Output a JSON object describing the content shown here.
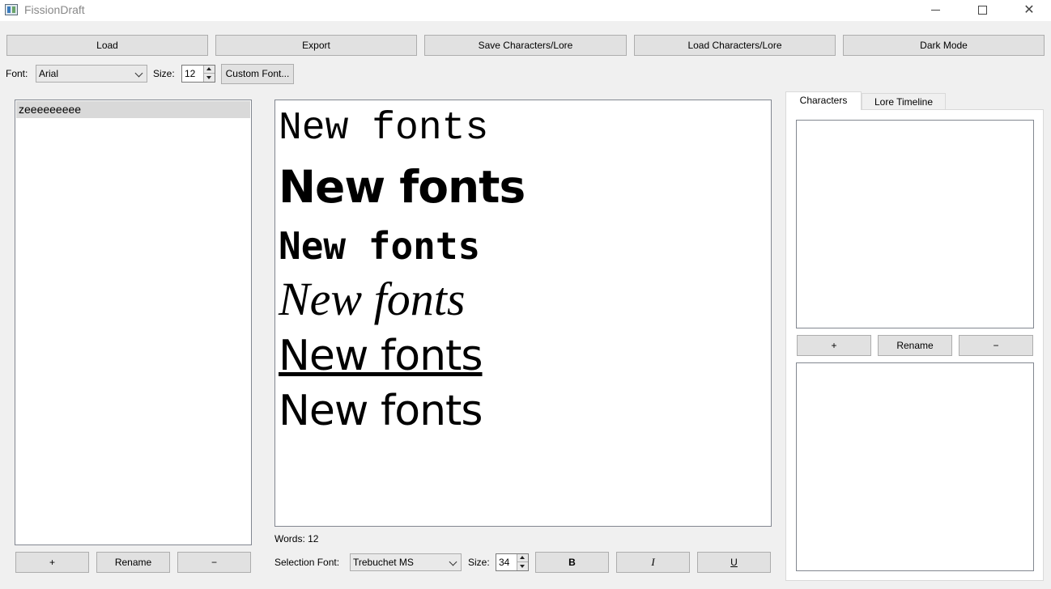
{
  "window": {
    "title": "FissionDraft",
    "app_icon": "app-icon",
    "controls": {
      "minimize": "minimize-icon",
      "maximize": "maximize-icon",
      "close": "✕"
    }
  },
  "toolbar": {
    "load": "Load",
    "export": "Export",
    "save_characters_lore": "Save Characters/Lore",
    "load_characters_lore": "Load Characters/Lore",
    "dark_mode": "Dark Mode"
  },
  "font_row": {
    "font_label": "Font:",
    "font_value": "Arial",
    "size_label": "Size:",
    "size_value": "12",
    "custom_font": "Custom Font..."
  },
  "chapters": {
    "items": [
      "zeeeeeeeee"
    ],
    "add": "+",
    "rename": "Rename",
    "remove": "−"
  },
  "editor": {
    "lines": [
      "New fonts",
      "New fonts",
      "New fonts",
      "New fonts",
      "New fonts",
      "New fonts"
    ],
    "word_count": "Words: 12"
  },
  "format_bar": {
    "selection_font_label": "Selection Font:",
    "selection_font_value": "Trebuchet MS",
    "size_label": "Size:",
    "size_value": "34",
    "bold": "B",
    "italic": "I",
    "underline": "U"
  },
  "side_panel": {
    "tabs": [
      "Characters",
      "Lore Timeline"
    ],
    "active_tab": "Characters",
    "add": "+",
    "rename": "Rename",
    "remove": "−"
  }
}
